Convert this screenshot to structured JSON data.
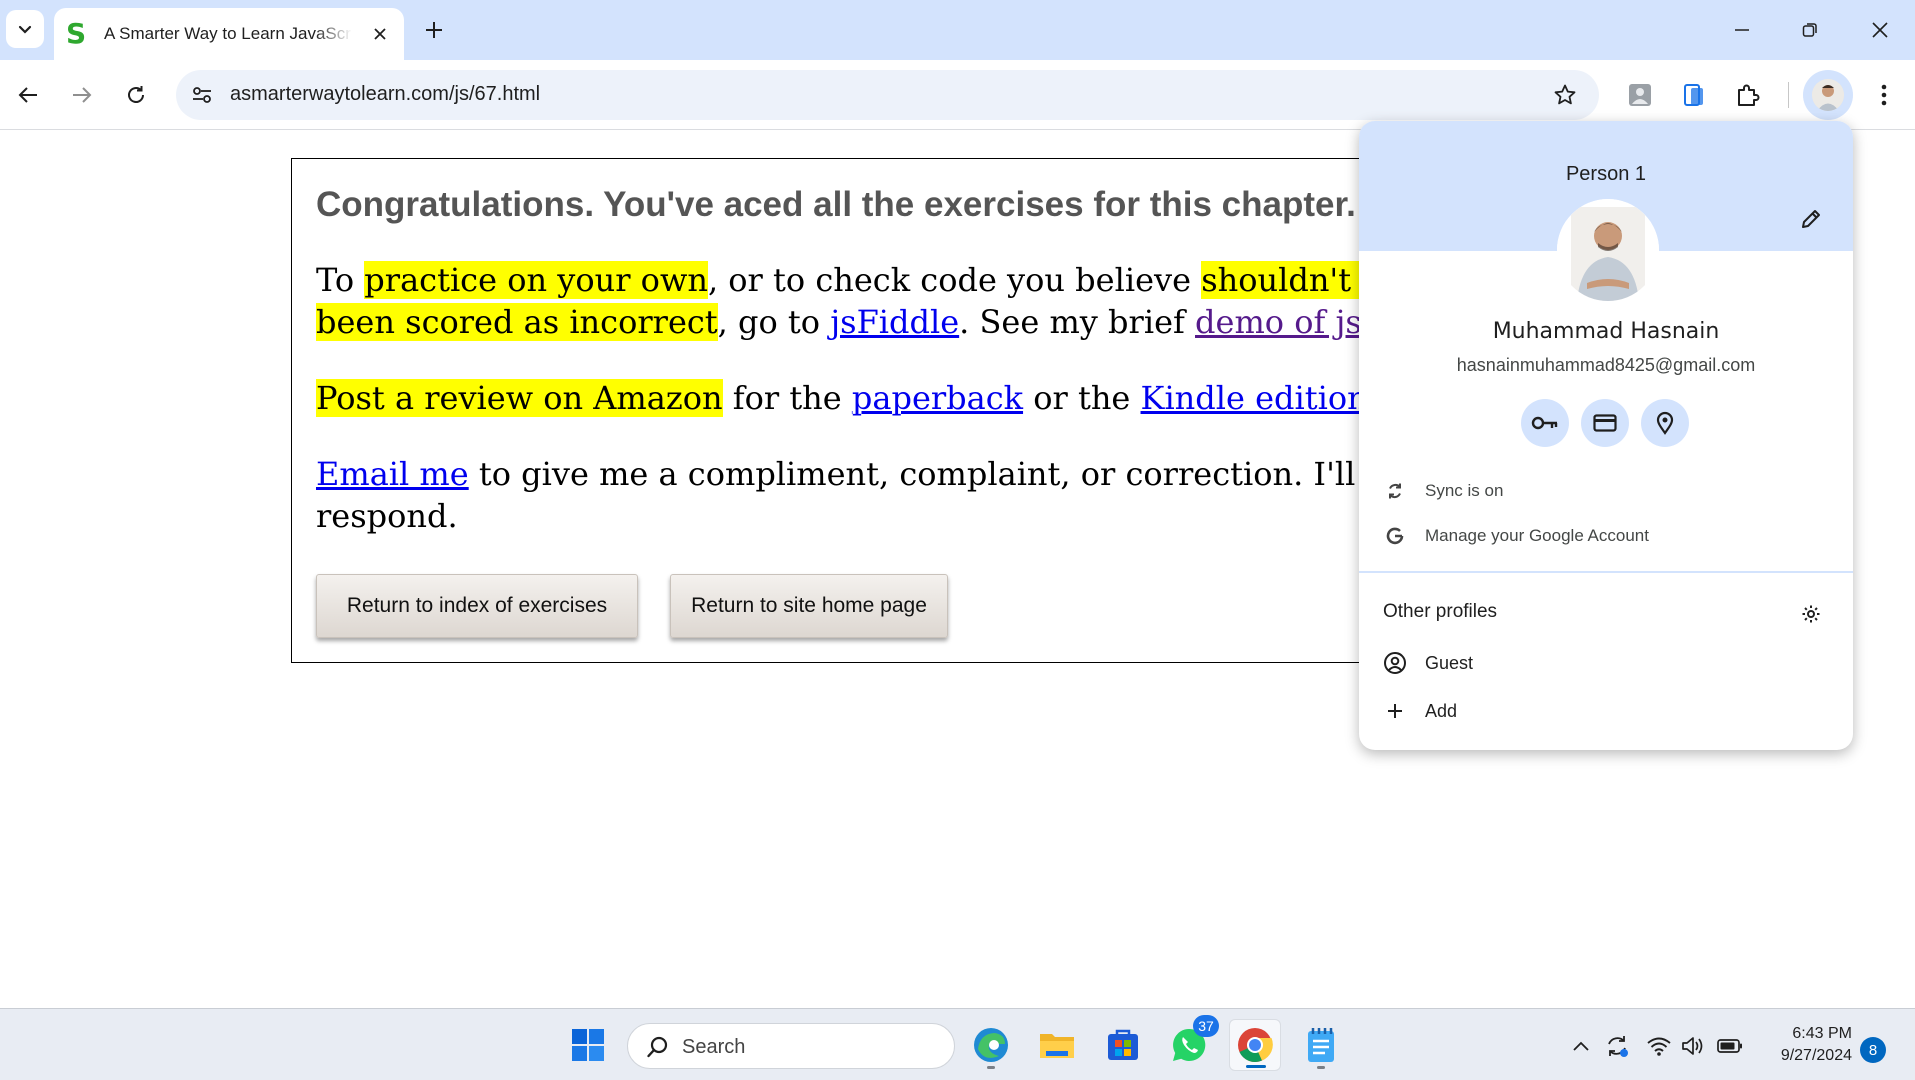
{
  "browser": {
    "tab": {
      "title": "A Smarter Way to Learn JavaScript",
      "favicon_letter": "S",
      "favicon_color": "#2fa82f"
    },
    "url": "asmarterwaytolearn.com/js/67.html"
  },
  "page": {
    "heading": "Congratulations. You've aced all the exercises for this chapter.",
    "p1": {
      "t1": "To ",
      "h1": "practice on your own",
      "t2": ", or to check code you believe ",
      "h2": "shouldn't have",
      "h3": "been scored as incorrect",
      "t3": ", go to ",
      "link1": "jsFiddle",
      "t4": ". See my brief ",
      "link2": "demo of jsFiddle"
    },
    "p2": {
      "h1": "Post a review on Amazon",
      "t1": " for the ",
      "link1": "paperback",
      "t2": " or the ",
      "link2": "Kindle edition",
      "t3": "."
    },
    "p3": {
      "link1": "Email me",
      "t1": " to give me a compliment, complaint, or correction. I'll",
      "t2": "respond."
    },
    "buttons": {
      "index": "Return to index of exercises",
      "home": "Return to site home page"
    },
    "highlight_color": "#ffff00"
  },
  "profile_menu": {
    "profile_label": "Person 1",
    "name": "Muhammad Hasnain",
    "email": "hasnainmuhammad8425@gmail.com",
    "quick_actions": [
      "key-icon",
      "card-icon",
      "location-icon"
    ],
    "sync": "Sync is on",
    "manage": "Manage your Google Account",
    "other_profiles": "Other profiles",
    "guest": "Guest",
    "add": "Add",
    "accent": "#d3e3fd"
  },
  "taskbar": {
    "search_placeholder": "Search",
    "whatsapp_badge": "37",
    "time": "6:43 PM",
    "date": "9/27/2024",
    "notifications": "8"
  }
}
